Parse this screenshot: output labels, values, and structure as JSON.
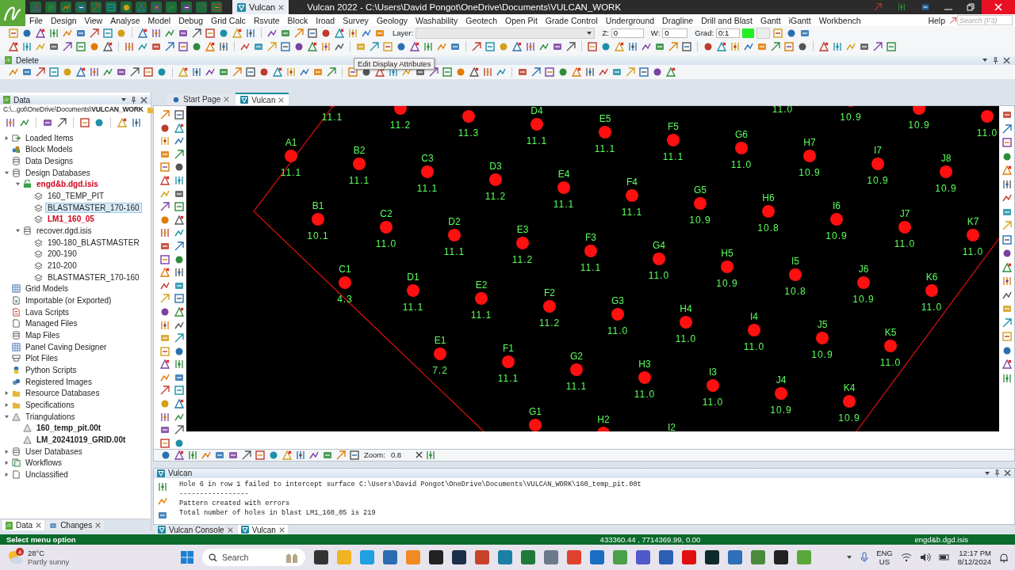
{
  "window": {
    "title": "Vulcan 2022 - C:\\Users\\David Pongot\\OneDrive\\Documents\\VULCAN_WORK",
    "tab": "Vulcan"
  },
  "menu": {
    "items": [
      "File",
      "Design",
      "View",
      "Analyse",
      "Model",
      "Debug",
      "Grid Calc",
      "Rsvute",
      "Block",
      "Iroad",
      "Survey",
      "Geology",
      "Washability",
      "Geotech",
      "Open Pit",
      "Grade Control",
      "Underground",
      "Dragline",
      "Drill and Blast",
      "Gantt",
      "iGantt",
      "Workbench"
    ],
    "help": "Help",
    "search": {
      "placeholder": "Search (F3)"
    }
  },
  "toolbar": {
    "layer_label": "Layer:",
    "z_label": "Z:",
    "z_value": "0",
    "w_label": "W:",
    "w_value": "0",
    "grad_label": "Grad:",
    "grad_value": "0:1"
  },
  "tooltip": "Edit Display Attributes",
  "delete_panel": {
    "title": "Delete"
  },
  "data_panel": {
    "title": "Data",
    "path": "C:\\...got\\OneDrive\\Documents\\**VULCAN_WORK**",
    "tree": [
      {
        "label": "Loaded Items",
        "kind": "loaded",
        "expanded": false,
        "selected": false,
        "active": false
      },
      {
        "label": "Block Models",
        "kind": "blocks",
        "selected": false,
        "active": false
      },
      {
        "label": "Data Designs",
        "kind": "database",
        "selected": false,
        "active": false
      },
      {
        "label": "Design Databases",
        "kind": "database",
        "expanded": true,
        "selected": false,
        "active": false,
        "children": [
          {
            "label": "engd&b.dgd.isis",
            "kind": "lock",
            "expanded": true,
            "selected": false,
            "active": true,
            "color": "#d0021b",
            "children": [
              {
                "label": "160_TEMP_PIT",
                "kind": "layer",
                "selected": false,
                "active": false
              },
              {
                "label": "BLASTMASTER_170-160",
                "kind": "layer",
                "selected": true,
                "active": false
              },
              {
                "label": "LM1_160_05",
                "kind": "layer",
                "selected": false,
                "active": true,
                "color": "#d0021b"
              }
            ]
          },
          {
            "label": "recover.dgd.isis",
            "kind": "database",
            "expanded": true,
            "selected": false,
            "active": false,
            "children": [
              {
                "label": "190-180_BLASTMASTER",
                "kind": "layer",
                "selected": false,
                "active": false
              },
              {
                "label": "200-190",
                "kind": "layer",
                "selected": false,
                "active": false
              },
              {
                "label": "210-200",
                "kind": "layer",
                "selected": false,
                "active": false
              },
              {
                "label": "BLASTMASTER_170-160",
                "kind": "layer",
                "selected": false,
                "active": false
              }
            ]
          }
        ]
      },
      {
        "label": "Grid Models",
        "kind": "grid",
        "selected": false,
        "active": false
      },
      {
        "label": "Importable (or Exported)",
        "kind": "import",
        "selected": false,
        "active": false
      },
      {
        "label": "Lava Scripts",
        "kind": "script",
        "selected": false,
        "active": false
      },
      {
        "label": "Managed Files",
        "kind": "file",
        "selected": false,
        "active": false
      },
      {
        "label": "Map Files",
        "kind": "database",
        "selected": false,
        "active": false
      },
      {
        "label": "Panel Caving Designer",
        "kind": "grid",
        "selected": false,
        "active": false
      },
      {
        "label": "Plot Files",
        "kind": "plot",
        "selected": false,
        "active": false
      },
      {
        "label": "Python Scripts",
        "kind": "python",
        "selected": false,
        "active": false
      },
      {
        "label": "Registered Images",
        "kind": "images",
        "selected": false,
        "active": false
      },
      {
        "label": "Resource Databases",
        "kind": "folder",
        "expanded": false,
        "selected": false,
        "active": false
      },
      {
        "label": "Specifications",
        "kind": "folder",
        "expanded": false,
        "selected": false,
        "active": false
      },
      {
        "label": "Triangulations",
        "kind": "triangle",
        "expanded": true,
        "selected": false,
        "active": false,
        "children": [
          {
            "label": "160_temp_pit.00t",
            "kind": "triangle",
            "selected": false,
            "active": true
          },
          {
            "label": "LM_20241019_GRID.00t",
            "kind": "triangle",
            "selected": false,
            "active": true
          }
        ]
      },
      {
        "label": "User Databases",
        "kind": "database",
        "expanded": false,
        "selected": false,
        "active": false
      },
      {
        "label": "Workflows",
        "kind": "workflow",
        "expanded": false,
        "selected": false,
        "active": false
      },
      {
        "label": "Unclassified",
        "kind": "file",
        "expanded": false,
        "selected": false,
        "active": false
      }
    ]
  },
  "tabs": [
    {
      "label": "Start Page",
      "selected": false
    },
    {
      "label": "Vulcan",
      "selected": true
    }
  ],
  "pattern": {
    "lines": [
      {
        "holes": [
          {
            "value": "11.0"
          },
          {
            "value": "10.9"
          },
          {
            "value": "10.9"
          },
          {
            "value": "11.0"
          }
        ]
      },
      {
        "holes": [
          {
            "value": "11.1"
          },
          {
            "value": "11.2"
          },
          {
            "value": "11.3"
          },
          {
            "label": "D4",
            "value": "11.1"
          },
          {
            "label": "E5",
            "value": "11.1"
          },
          {
            "label": "F5",
            "value": "11.1"
          },
          {
            "label": "G6",
            "value": "11.0"
          },
          {
            "label": "H7",
            "value": "10.9"
          },
          {
            "label": "I7",
            "value": "10.9"
          },
          {
            "label": "J8",
            "value": "10.9"
          }
        ]
      },
      {
        "holes": [
          {
            "label": "A1",
            "value": "11.1"
          },
          {
            "label": "B2",
            "value": "11.1"
          },
          {
            "label": "C3",
            "value": "11.1"
          },
          {
            "label": "D3",
            "value": "11.2"
          },
          {
            "label": "E4",
            "value": "11.1"
          },
          {
            "label": "F4",
            "value": "11.1"
          },
          {
            "label": "G5",
            "value": "10.9"
          },
          {
            "label": "H6",
            "value": "10.8"
          },
          {
            "label": "I6",
            "value": "10.9"
          },
          {
            "label": "J7",
            "value": "11.0"
          },
          {
            "label": "K7",
            "value": "11.0"
          }
        ]
      },
      {
        "holes": [
          {
            "label": "B1",
            "value": "10.1"
          },
          {
            "label": "C2",
            "value": "11.0"
          },
          {
            "label": "D2",
            "value": "11.1"
          },
          {
            "label": "E3",
            "value": "11.2"
          },
          {
            "label": "F3",
            "value": "11.1"
          },
          {
            "label": "G4",
            "value": "11.0"
          },
          {
            "label": "H5",
            "value": "10.9"
          },
          {
            "label": "I5",
            "value": "10.8"
          },
          {
            "label": "J6",
            "value": "10.9"
          },
          {
            "label": "K6",
            "value": "11.0"
          }
        ]
      },
      {
        "holes": [
          {
            "label": "C1",
            "value": "4.3"
          },
          {
            "label": "D1",
            "value": "11.1"
          },
          {
            "label": "E2",
            "value": "11.1"
          },
          {
            "label": "F2",
            "value": "11.2"
          },
          {
            "label": "G3",
            "value": "11.0"
          },
          {
            "label": "H4",
            "value": "11.0"
          },
          {
            "label": "I4",
            "value": "11.0"
          },
          {
            "label": "J5",
            "value": "10.9"
          },
          {
            "label": "K5",
            "value": "11.0"
          }
        ]
      },
      {
        "holes": [
          {
            "label": "E1",
            "value": "7.2"
          },
          {
            "label": "F1",
            "value": "11.1"
          },
          {
            "label": "G2",
            "value": "11.1"
          },
          {
            "label": "H3",
            "value": "11.0"
          },
          {
            "label": "I3",
            "value": "11.0"
          },
          {
            "label": "J4",
            "value": "10.9"
          },
          {
            "label": "K4",
            "value": "10.9"
          }
        ]
      },
      {
        "holes": [
          {
            "label": "G1"
          },
          {
            "label": "H2"
          },
          {
            "label": "I2"
          }
        ]
      }
    ]
  },
  "canvas_toolbar": {
    "zoom_label": "Zoom:",
    "zoom_value": "0.8"
  },
  "console": {
    "title": "Vulcan",
    "lines": [
      "Hole 6 in row 1 failed to intercept surface C:\\Users\\David Pongot\\OneDrive\\Documents\\VULCAN_WORK\\160_temp_pit.00t",
      "-----------------",
      "Pattern created with errors",
      "Total number of holes in blast LM1_160_05 is 219"
    ]
  },
  "left_tabs": [
    {
      "label": "Data",
      "selected": true
    },
    {
      "label": "Changes",
      "selected": false
    }
  ],
  "bottom_tabs": [
    {
      "label": "Vulcan Console",
      "selected": false
    },
    {
      "label": "Vulcan",
      "selected": true
    }
  ],
  "status_bar": {
    "message": "Select menu option",
    "coordinates": "433360.44 , 7714369.99, 0.00",
    "database": "engd&b.dgd.isis"
  },
  "taskbar": {
    "weather": {
      "badge": "4",
      "temperature": "28°C",
      "condition": "Partly sunny"
    },
    "search": {
      "placeholder": "Search"
    },
    "language": "ENG",
    "region": "US",
    "time": "12:17 PM",
    "date": "8/12/2024"
  }
}
